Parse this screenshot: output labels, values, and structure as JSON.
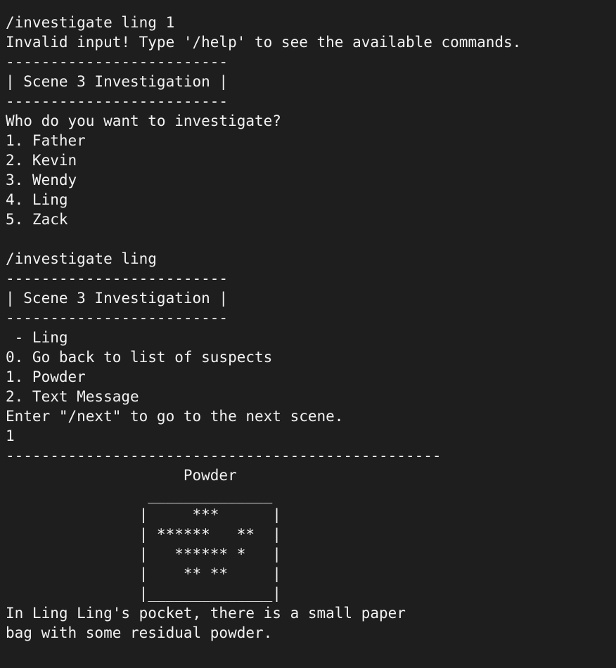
{
  "terminal": {
    "lines": [
      "/investigate ling 1",
      "Invalid input! Type '/help' to see the available commands.",
      "-------------------------",
      "| Scene 3 Investigation |",
      "-------------------------",
      "Who do you want to investigate?",
      "1. Father",
      "2. Kevin",
      "3. Wendy",
      "4. Ling",
      "5. Zack",
      "",
      "/investigate ling",
      "-------------------------",
      "| Scene 3 Investigation |",
      "-------------------------",
      " - Ling",
      "0. Go back to list of suspects",
      "1. Powder",
      "2. Text Message",
      "Enter \"/next\" to go to the next scene.",
      "1",
      "-------------------------------------------------",
      "                    Powder",
      "                ______________",
      "               |     ***      |",
      "               | ******   **  |",
      "               |   ****** *   |",
      "               |    ** **     |",
      "               |______________|",
      "In Ling Ling's pocket, there is a small paper",
      "bag with some residual powder."
    ]
  }
}
